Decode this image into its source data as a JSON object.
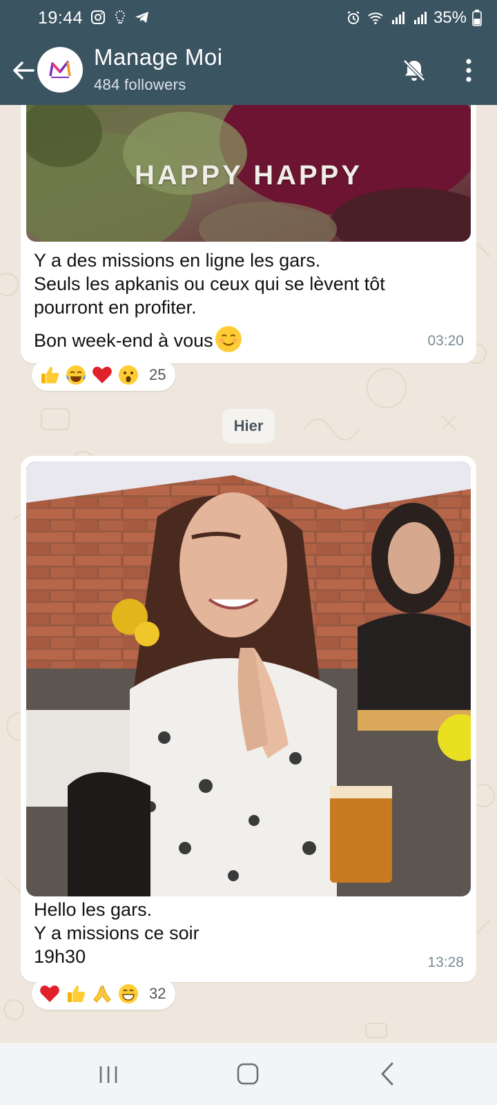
{
  "status_bar": {
    "time": "19:44",
    "battery": "35%"
  },
  "header": {
    "channel_name": "Manage Moi",
    "followers": "484 followers",
    "avatar_logo": "Manage Moi logo"
  },
  "messages": [
    {
      "media_caption_text": "HAPPY HAPPY",
      "text_lines": [
        "Y a des missions en ligne les gars.",
        "Seuls les apkanis ou ceux qui se lèvent tôt",
        "pourront en profiter.",
        "Bon week-end à vous"
      ],
      "time": "03:20",
      "reactions": [
        "thumbs-up",
        "tears-of-joy",
        "red-heart",
        "surprised-face"
      ],
      "reaction_count": "25"
    },
    {
      "text_lines": [
        "Hello les gars.",
        "Y a missions ce soir",
        "19h30"
      ],
      "time": "13:28",
      "reactions": [
        "red-heart",
        "thumbs-up",
        "folded-hands",
        "grinning-face"
      ],
      "reaction_count": "32"
    }
  ],
  "date_separator": "Hier",
  "colors": {
    "header": "#3b5462",
    "chat_background": "#efe7dd",
    "bubble": "#ffffff",
    "time_text": "#7a8b94"
  }
}
